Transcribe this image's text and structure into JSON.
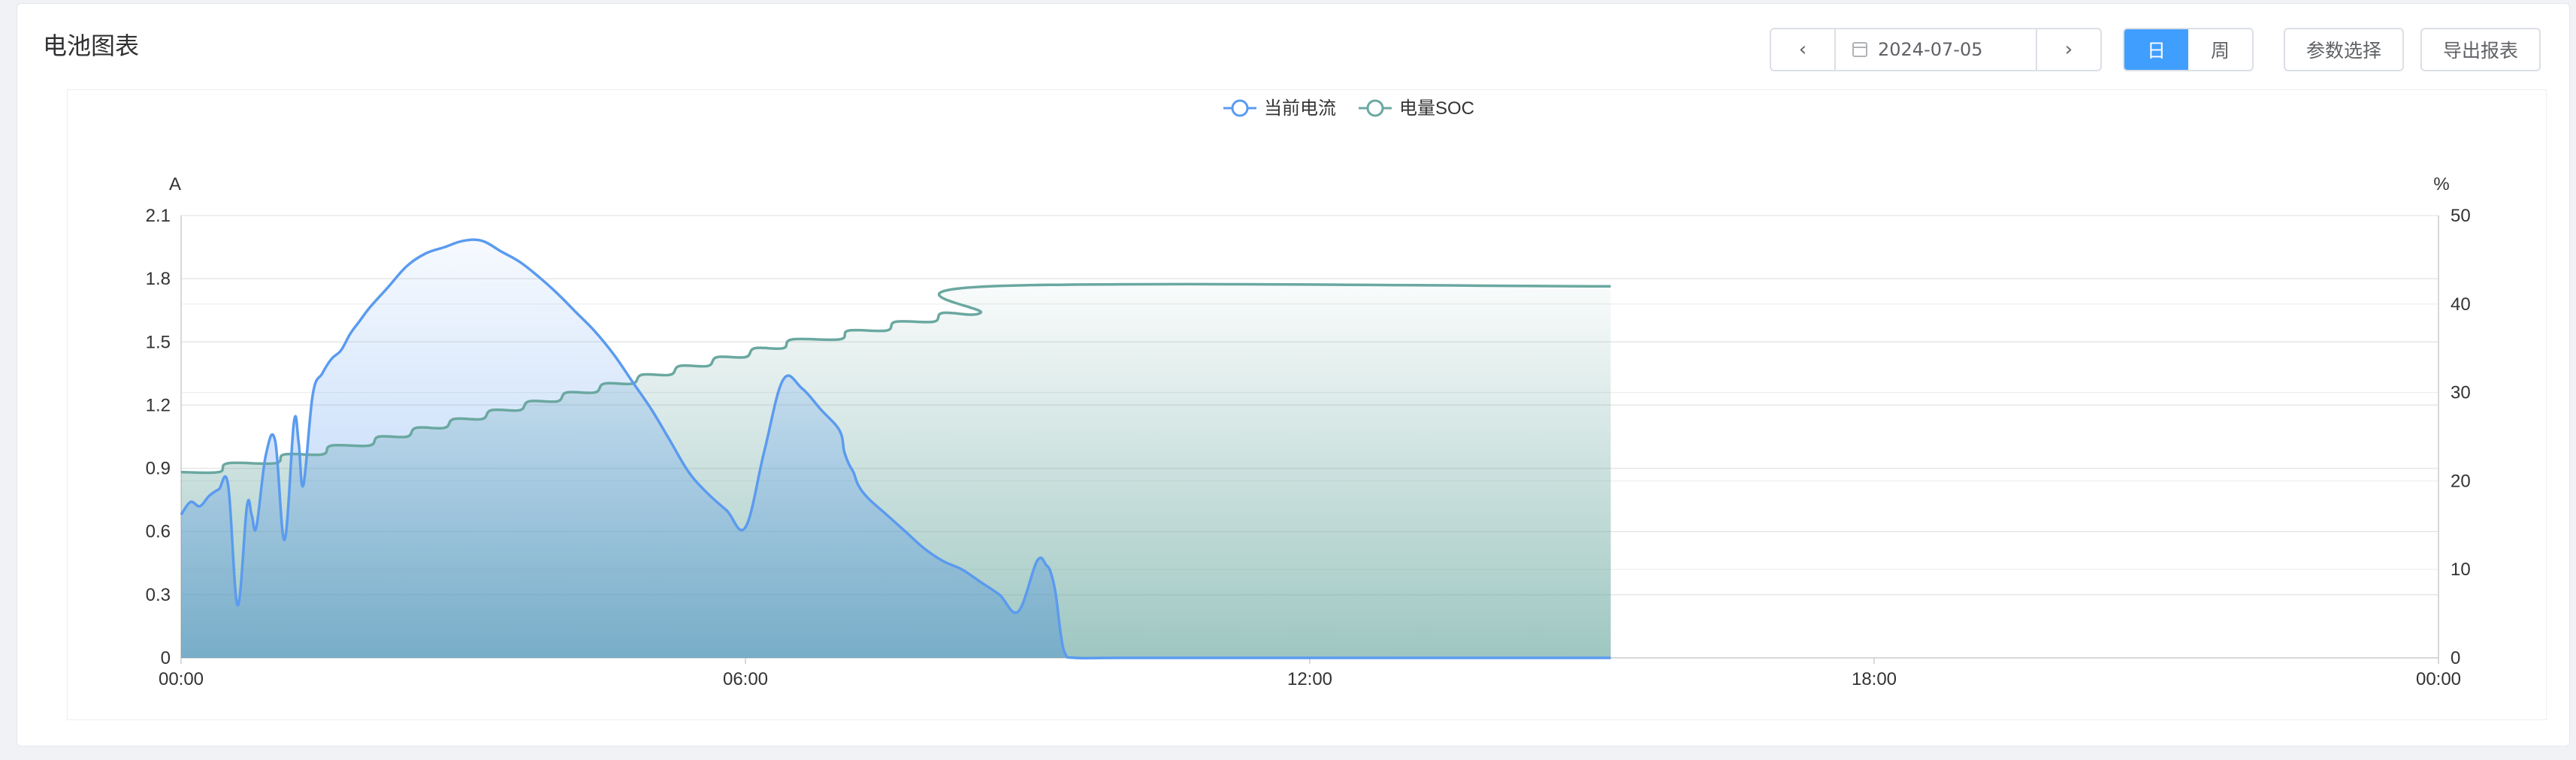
{
  "page": {
    "title": "电池图表"
  },
  "toolbar": {
    "prev_icon": "‹",
    "next_icon": "›",
    "date_value": "2024-07-05",
    "period_day": "日",
    "period_week": "周",
    "params_label": "参数选择",
    "export_label": "导出报表"
  },
  "colors": {
    "current": "#5b9bef",
    "soc": "#6aa8a0",
    "active": "#409eff"
  },
  "chart_data": {
    "type": "area",
    "legend": [
      "当前电流",
      "电量SOC"
    ],
    "legend_position": "top-center",
    "grid": true,
    "x_axis": {
      "min_hours": 0,
      "max_hours": 24,
      "tick_labels": [
        "00:00",
        "06:00",
        "12:00",
        "18:00",
        "00:00"
      ]
    },
    "y_left": {
      "unit": "A",
      "min": 0,
      "max": 2.1,
      "ticks": [
        "0",
        "0.3",
        "0.6",
        "0.9",
        "1.2",
        "1.5",
        "1.8",
        "2.1"
      ]
    },
    "y_right": {
      "unit": "%",
      "min": 0,
      "max": 50,
      "ticks": [
        "0",
        "10",
        "20",
        "30",
        "40",
        "50"
      ]
    },
    "series": [
      {
        "name": "当前电流",
        "axis": "left",
        "x_hours": [
          0,
          0.1,
          0.2,
          0.3,
          0.4,
          0.5,
          0.6,
          0.7,
          0.75,
          0.8,
          0.9,
          1.0,
          1.1,
          1.2,
          1.25,
          1.3,
          1.4,
          1.5,
          1.6,
          1.7,
          1.8,
          1.9,
          2.0,
          2.2,
          2.4,
          2.6,
          2.8,
          3.0,
          3.2,
          3.4,
          3.6,
          3.8,
          4.0,
          4.2,
          4.4,
          4.6,
          4.8,
          5.0,
          5.2,
          5.4,
          5.6,
          5.8,
          6.0,
          6.2,
          6.4,
          6.6,
          6.8,
          7.0,
          7.05,
          7.1,
          7.15,
          7.2,
          7.3,
          7.5,
          7.7,
          7.9,
          8.1,
          8.3,
          8.5,
          8.7,
          8.9,
          9.1,
          9.2,
          9.25,
          9.3,
          9.35,
          9.4,
          9.5,
          10.0,
          12.0,
          15.2
        ],
        "values": [
          0.68,
          0.74,
          0.72,
          0.77,
          0.8,
          0.82,
          0.25,
          0.72,
          0.68,
          0.62,
          0.96,
          1.03,
          0.56,
          1.12,
          1.02,
          0.82,
          1.25,
          1.35,
          1.42,
          1.46,
          1.54,
          1.6,
          1.66,
          1.76,
          1.86,
          1.92,
          1.95,
          1.98,
          1.98,
          1.93,
          1.88,
          1.81,
          1.73,
          1.64,
          1.55,
          1.44,
          1.31,
          1.18,
          1.03,
          0.88,
          0.78,
          0.7,
          0.62,
          0.98,
          1.32,
          1.28,
          1.18,
          1.08,
          0.98,
          0.92,
          0.88,
          0.82,
          0.76,
          0.68,
          0.6,
          0.52,
          0.46,
          0.42,
          0.36,
          0.3,
          0.22,
          0.46,
          0.44,
          0.4,
          0.3,
          0.12,
          0.02,
          0.0,
          0.0,
          0.0,
          0.0
        ]
      },
      {
        "name": "电量SOC",
        "axis": "right",
        "x_hours": [
          0,
          0.4,
          0.5,
          1.0,
          1.1,
          1.5,
          1.6,
          2.0,
          2.1,
          2.4,
          2.5,
          2.8,
          2.9,
          3.2,
          3.3,
          3.6,
          3.7,
          4.0,
          4.1,
          4.4,
          4.5,
          4.8,
          4.9,
          5.2,
          5.3,
          5.6,
          5.7,
          6.0,
          6.1,
          6.4,
          6.5,
          7.0,
          7.1,
          7.5,
          7.6,
          8.0,
          8.1,
          8.5,
          8.6,
          15.2
        ],
        "values": [
          21,
          21,
          22,
          22,
          23,
          23,
          24,
          24,
          25,
          25,
          26,
          26,
          27,
          27,
          28,
          28,
          29,
          29,
          30,
          30,
          31,
          31,
          32,
          32,
          33,
          33,
          34,
          34,
          35,
          35,
          36,
          36,
          37,
          37,
          38,
          38,
          39,
          39,
          42,
          42
        ]
      }
    ]
  }
}
